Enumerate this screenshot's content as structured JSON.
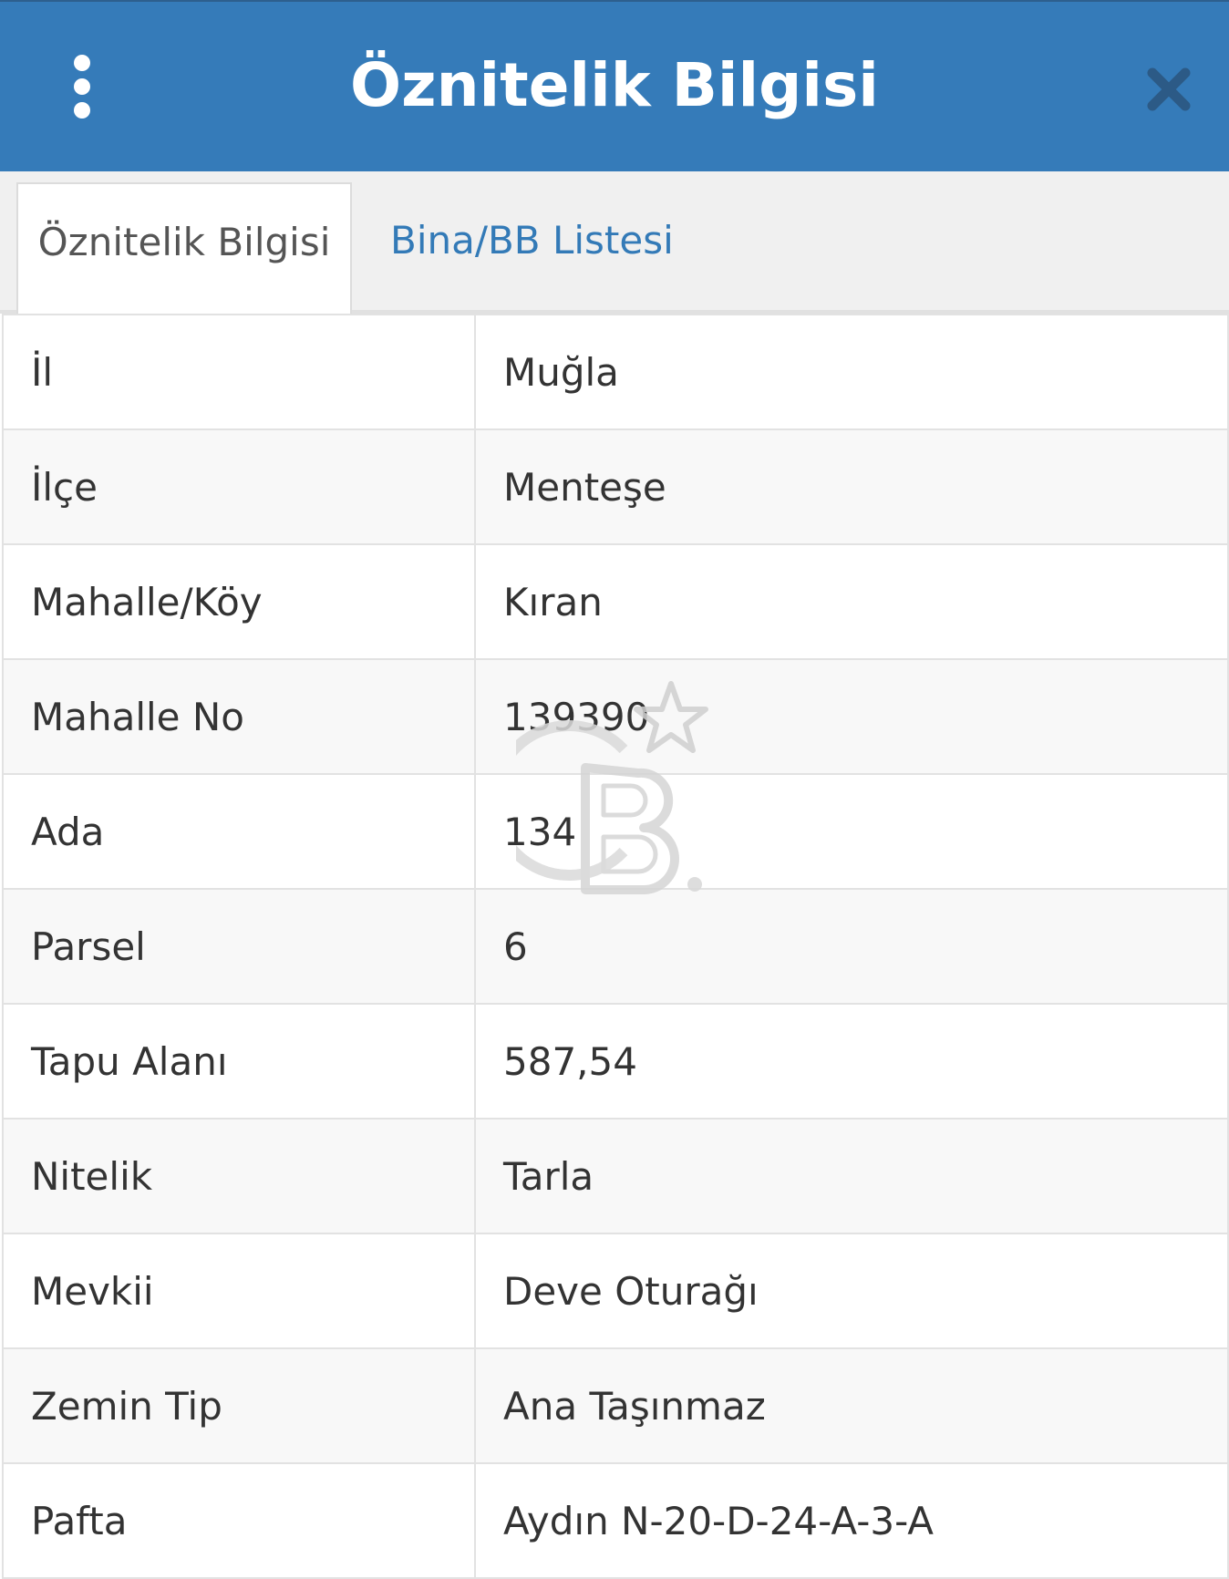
{
  "header": {
    "title": "Öznitelik Bilgisi",
    "menu_icon": "kebab-vertical-icon",
    "close_icon": "close-x-icon",
    "background_color": "#357bb9"
  },
  "tabs": [
    {
      "label": "Öznitelik Bilgisi",
      "active": true
    },
    {
      "label": "Bina/BB Listesi",
      "active": false
    }
  ],
  "attributes": [
    {
      "key": "İl",
      "value": "Muğla"
    },
    {
      "key": "İlçe",
      "value": "Menteşe"
    },
    {
      "key": "Mahalle/Köy",
      "value": "Kıran"
    },
    {
      "key": "Mahalle No",
      "value": "139390"
    },
    {
      "key": "Ada",
      "value": "134"
    },
    {
      "key": "Parsel",
      "value": "6"
    },
    {
      "key": "Tapu Alanı",
      "value": "587,54"
    },
    {
      "key": "Nitelik",
      "value": "Tarla"
    },
    {
      "key": "Mevkii",
      "value": "Deve Oturağı"
    },
    {
      "key": "Zemin Tip",
      "value": "Ana Taşınmaz"
    },
    {
      "key": "Pafta",
      "value": "Aydın N-20-D-24-A-3-A"
    }
  ],
  "watermark": {
    "icon": "cb-star-logo-icon"
  }
}
